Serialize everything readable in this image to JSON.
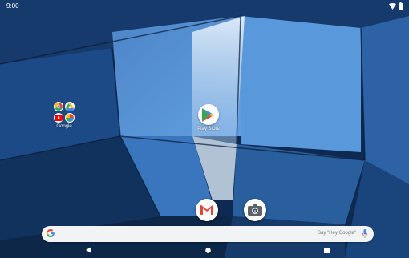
{
  "status_bar": {
    "time": "9:00"
  },
  "home": {
    "folder": {
      "label": "Google"
    },
    "play_store": {
      "label": "Play Store"
    }
  },
  "search": {
    "hint": "Say \"Hey Google\""
  },
  "colors": {
    "google_blue": "#4285F4",
    "google_red": "#EA4335",
    "google_yellow": "#FBBC05",
    "google_green": "#34A853"
  }
}
